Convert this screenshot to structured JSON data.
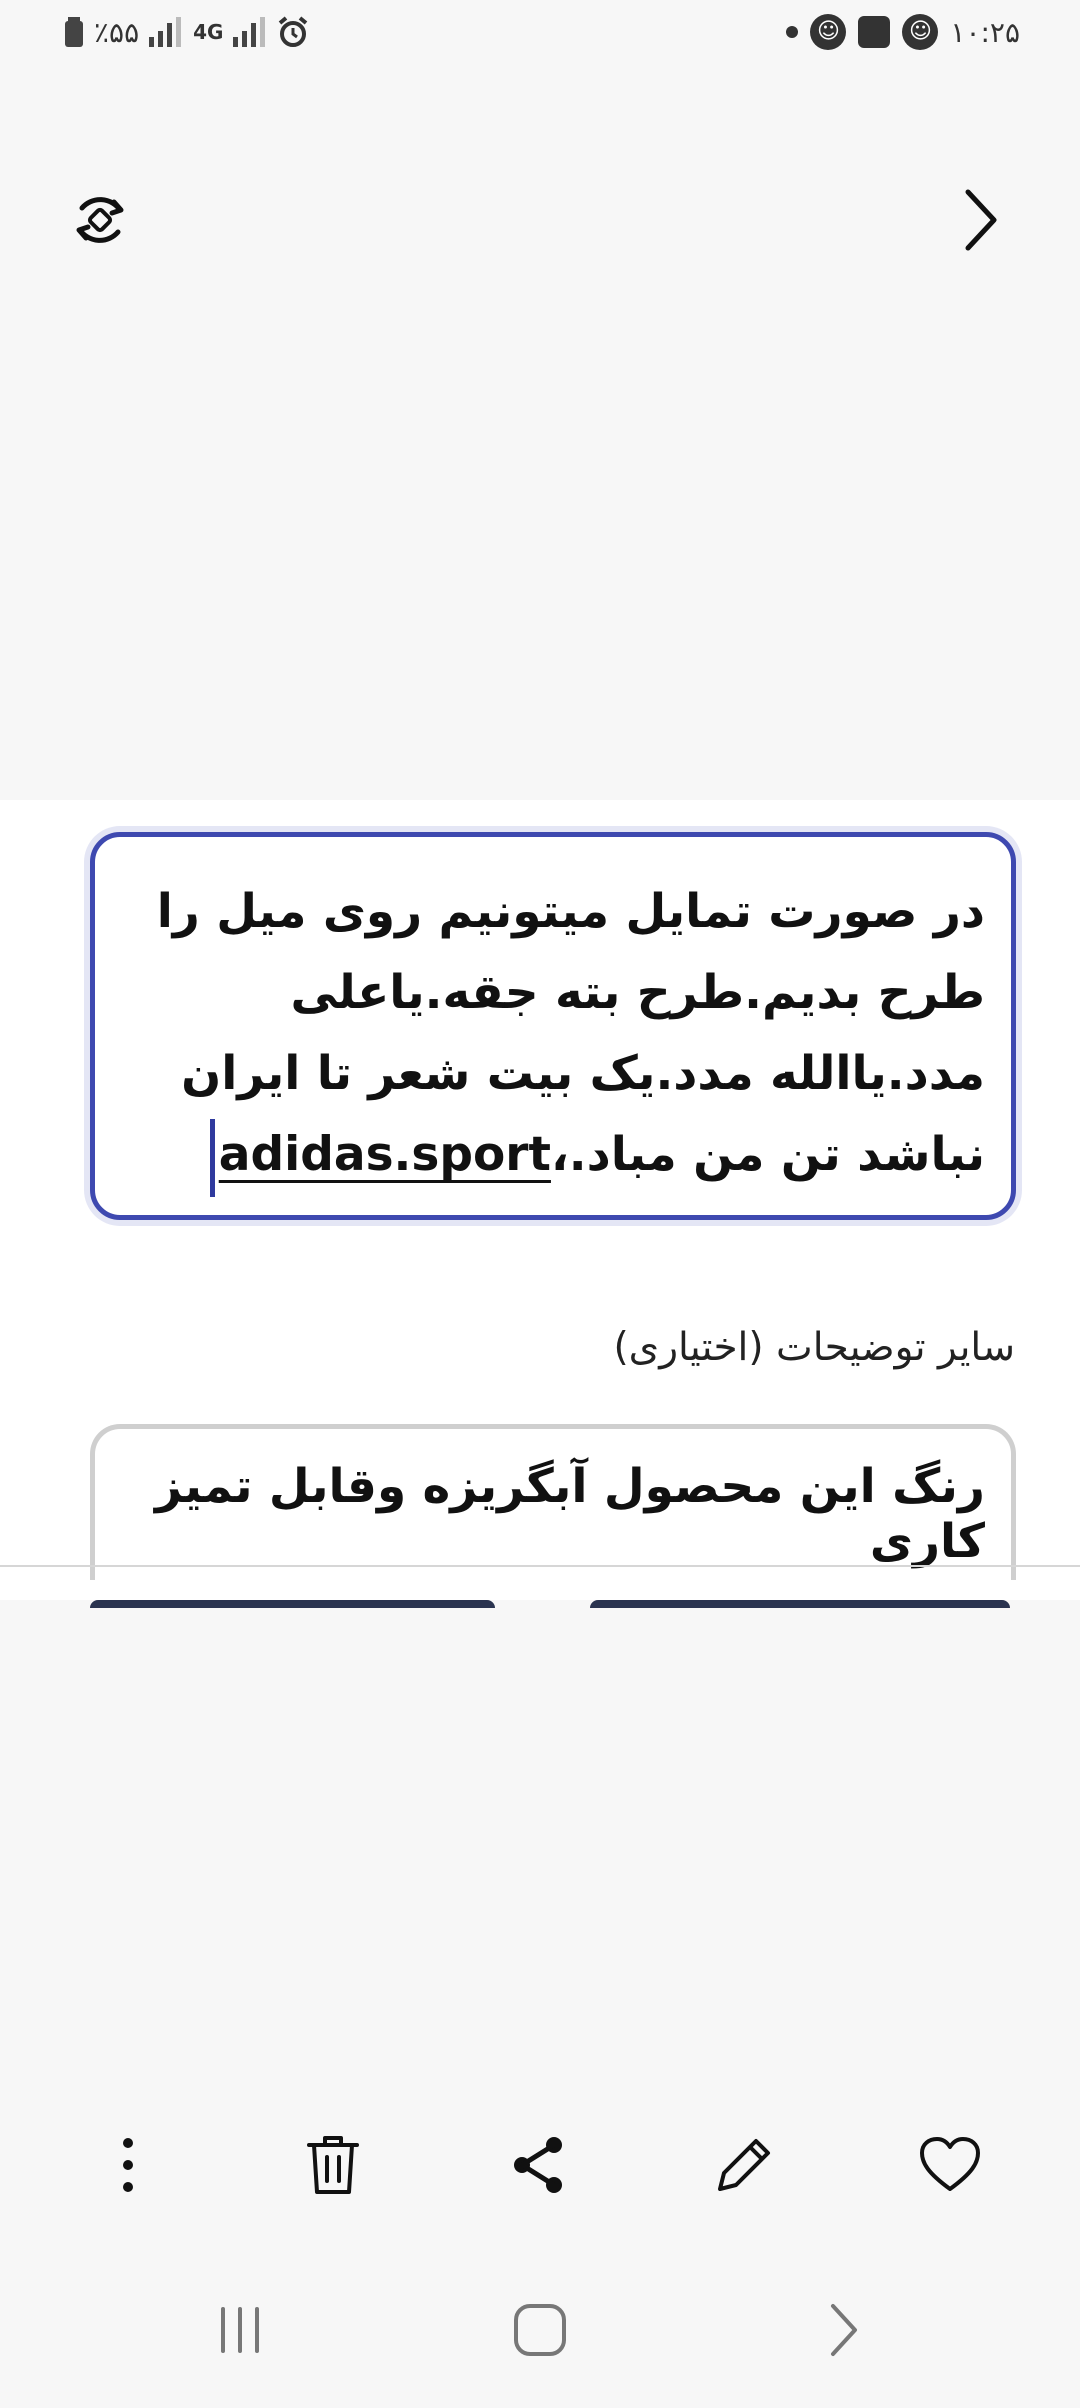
{
  "status_bar": {
    "battery": "٪۵۵",
    "network": "4G",
    "time": "۱۰:۲۵"
  },
  "toolbar": {
    "rotate_icon": "rotate-icon",
    "next_icon": "chevron-right-icon"
  },
  "description": {
    "text": "در صورت تمایل میتونیم روی میل را طرح بدیم.طرح بته جقه.یاعلی مدد.یاالله مدد.یک بیت شعر تا ایران نباشد تن من مباد.،",
    "tag": "adidas.sport"
  },
  "optional": {
    "label": "سایر توضیحات (اختیاری)",
    "value": "رنگ این محصول آبگریزه وقابل تمیز کاری"
  },
  "bottom_toolbar": {
    "icons": [
      "heart-icon",
      "edit-icon",
      "share-icon",
      "trash-icon",
      "more-icon"
    ]
  },
  "colors": {
    "accent": "#3e49b0",
    "field_border": "#cfcfcf",
    "background": "#f7f7f7"
  }
}
